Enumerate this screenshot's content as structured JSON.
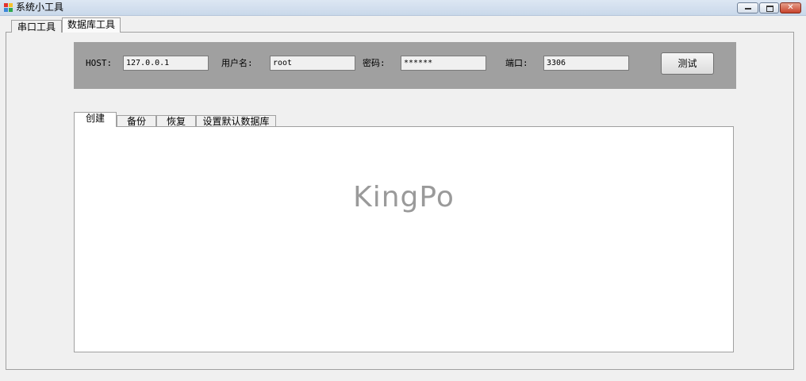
{
  "window": {
    "title": "系统小工具",
    "buttons": {
      "minimize": "—",
      "maximize": "□",
      "close": "✕"
    }
  },
  "main_tabs": [
    {
      "label": "串口工具"
    },
    {
      "label": "数据库工具",
      "selected": true
    }
  ],
  "connection": {
    "host_label": "HOST:",
    "host_value": "127.0.0.1",
    "user_label": "用户名:",
    "user_value": "root",
    "password_label": "密码:",
    "password_value": "******",
    "port_label": "端口:",
    "port_value": "3306",
    "test_button": "测试"
  },
  "inner_tabs": [
    {
      "label": "创建",
      "selected": true
    },
    {
      "label": "备份"
    },
    {
      "label": "恢复"
    },
    {
      "label": "设置默认数据库"
    }
  ],
  "content": {
    "watermark": "KingPo"
  },
  "colors": {
    "panel_bg": "#a0a0a0",
    "window_bg": "#f0f0f0",
    "watermark": "#9a9a9a"
  }
}
